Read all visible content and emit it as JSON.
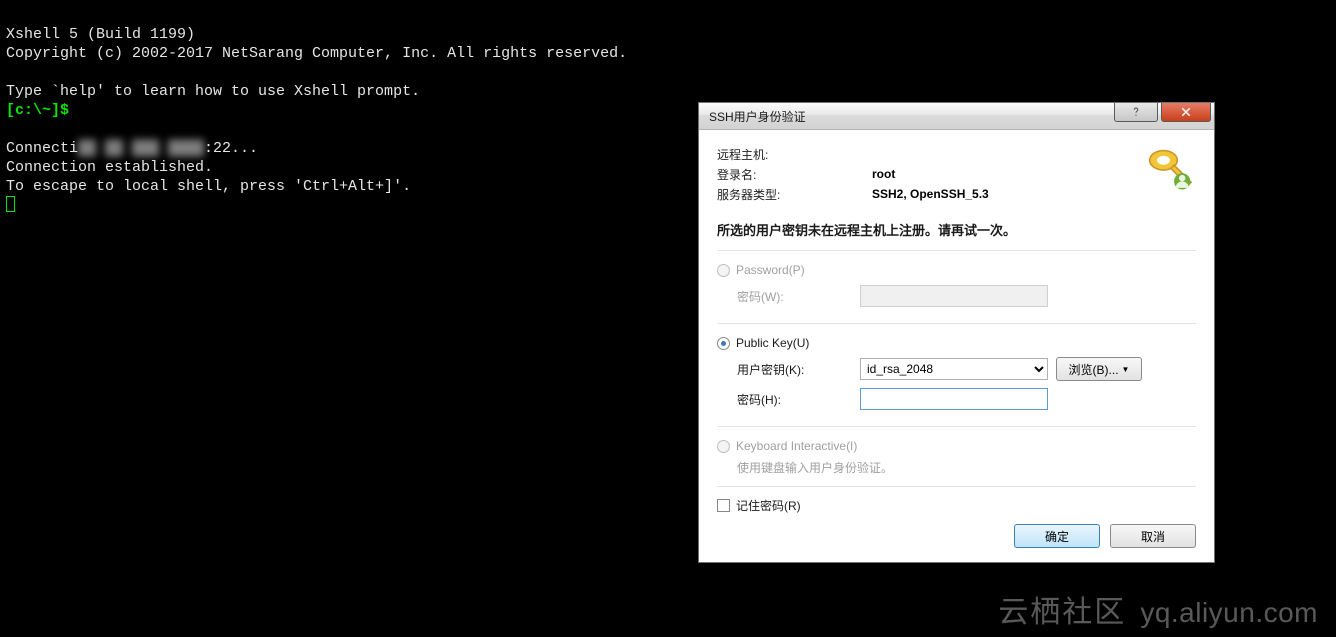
{
  "terminal": {
    "line1": "Xshell 5 (Build 1199)",
    "line2": "Copyright (c) 2002-2017 NetSarang Computer, Inc. All rights reserved.",
    "line3": "",
    "line4": "Type `help' to learn how to use Xshell prompt.",
    "prompt": "[c:\\~]$",
    "conn1a": "Connecti",
    "conn1b": ":22...",
    "conn2": "Connection established.",
    "conn3": "To escape to local shell, press 'Ctrl+Alt+]'."
  },
  "dialog": {
    "title": "SSH用户身份验证",
    "info": {
      "remote_host_label": "远程主机:",
      "login_label": "登录名:",
      "login_value": "root",
      "server_type_label": "服务器类型:",
      "server_type_value": "SSH2, OpenSSH_5.3"
    },
    "error": "所选的用户密钥未在远程主机上注册。请再试一次。",
    "password": {
      "radio": "Password(P)",
      "field_label": "密码(W):"
    },
    "publickey": {
      "radio": "Public Key(U)",
      "userkey_label": "用户密钥(K):",
      "userkey_value": "id_rsa_2048",
      "pass_label": "密码(H):",
      "browse": "浏览(B)..."
    },
    "ki": {
      "radio": "Keyboard Interactive(I)",
      "note": "使用键盘输入用户身份验证。"
    },
    "remember": "记住密码(R)",
    "ok": "确定",
    "cancel": "取消"
  },
  "watermark": {
    "cn": "云栖社区",
    "en": "yq.aliyun.com"
  }
}
